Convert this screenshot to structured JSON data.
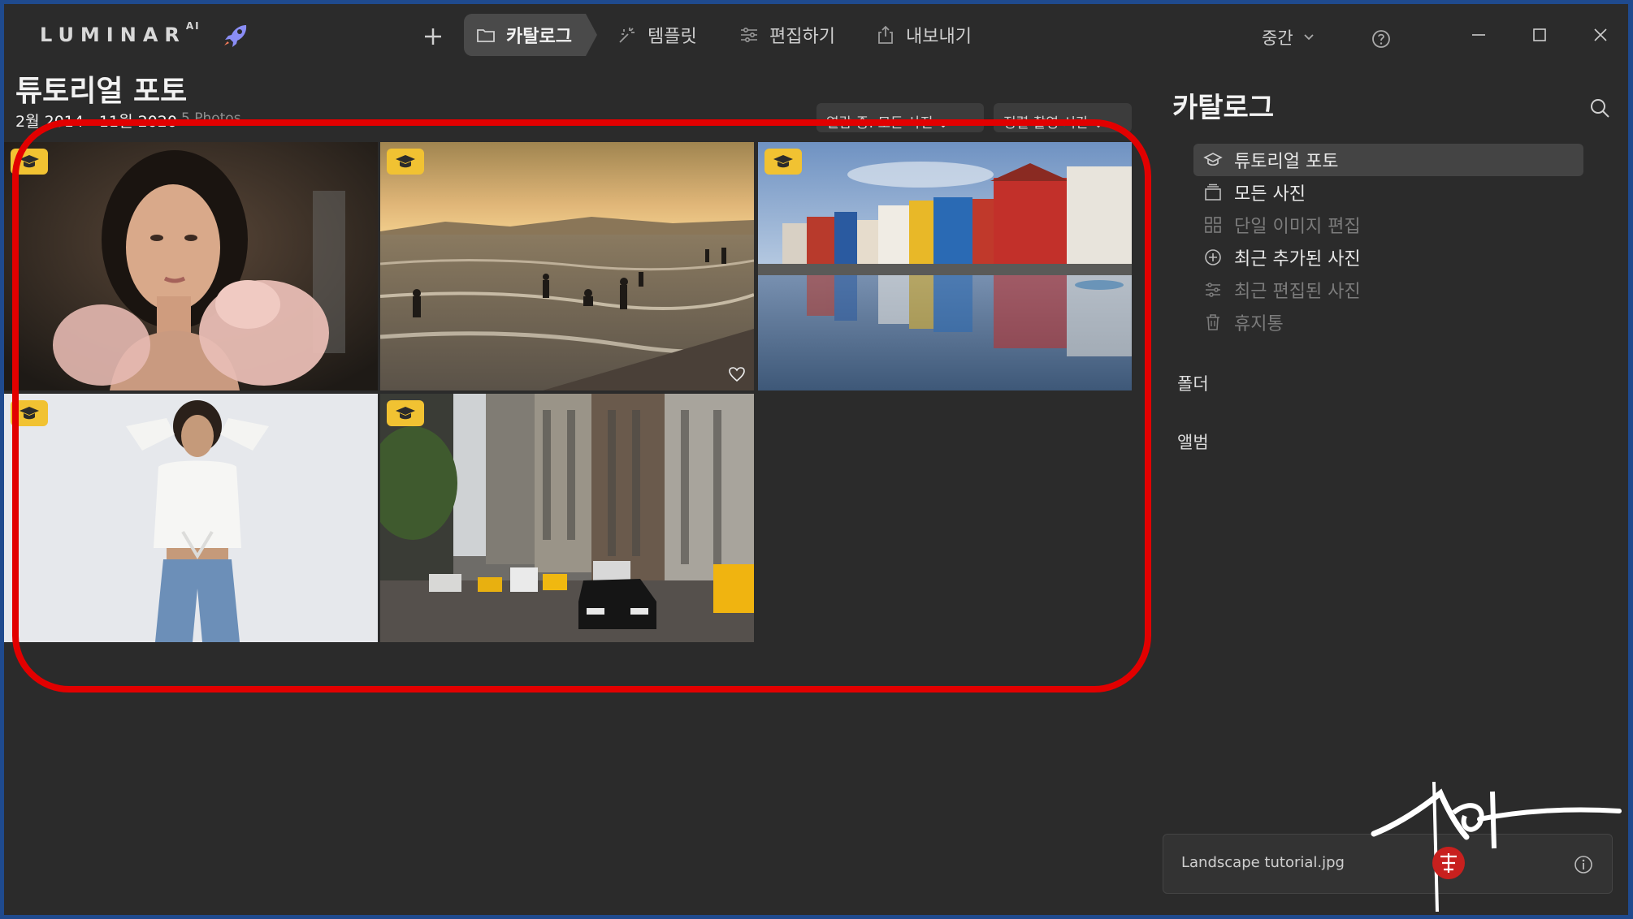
{
  "app": {
    "logo_text": "LUMINAR",
    "logo_sup": "AI"
  },
  "nav": {
    "catalog": "카탈로그",
    "templates": "템플릿",
    "edit": "편집하기",
    "export": "내보내기"
  },
  "quality": {
    "label": "중간"
  },
  "header": {
    "title": "튜토리얼 포토",
    "date_range": "2월 2014 - 11월 2020",
    "count": "5 Photos",
    "view_filter": "열람 중: 모든 사진",
    "sort": "정렬 촬영 시간"
  },
  "photos": [
    {
      "name": "portrait-pink-flower",
      "badge": true,
      "selected": false
    },
    {
      "name": "beach-sunset",
      "badge": true,
      "selected": false,
      "heart": true
    },
    {
      "name": "landscape-harbor-houses",
      "badge": true,
      "selected": true
    },
    {
      "name": "woman-white-shirt",
      "badge": true,
      "selected": false
    },
    {
      "name": "city-street-taxis",
      "badge": true,
      "selected": false
    }
  ],
  "sidebar": {
    "title": "카탈로그",
    "items": [
      {
        "label": "튜토리얼 포토",
        "icon": "graduation-cap-icon",
        "active": true,
        "dim": false
      },
      {
        "label": "모든 사진",
        "icon": "photos-stack-icon",
        "active": false,
        "dim": false
      },
      {
        "label": "단일 이미지 편집",
        "icon": "grid-icon",
        "active": false,
        "dim": true
      },
      {
        "label": "최근 추가된 사진",
        "icon": "plus-circle-icon",
        "active": false,
        "dim": false
      },
      {
        "label": "최근 편집된 사진",
        "icon": "sliders-icon",
        "active": false,
        "dim": true
      },
      {
        "label": "휴지통",
        "icon": "trash-icon",
        "active": false,
        "dim": true
      }
    ],
    "folders_label": "폴더",
    "albums_label": "앨범"
  },
  "infobar": {
    "filename": "Landscape tutorial.jpg"
  },
  "colors": {
    "selection": "#4fc3f7",
    "badge": "#f1c232",
    "highlight_ring": "#e20000"
  }
}
